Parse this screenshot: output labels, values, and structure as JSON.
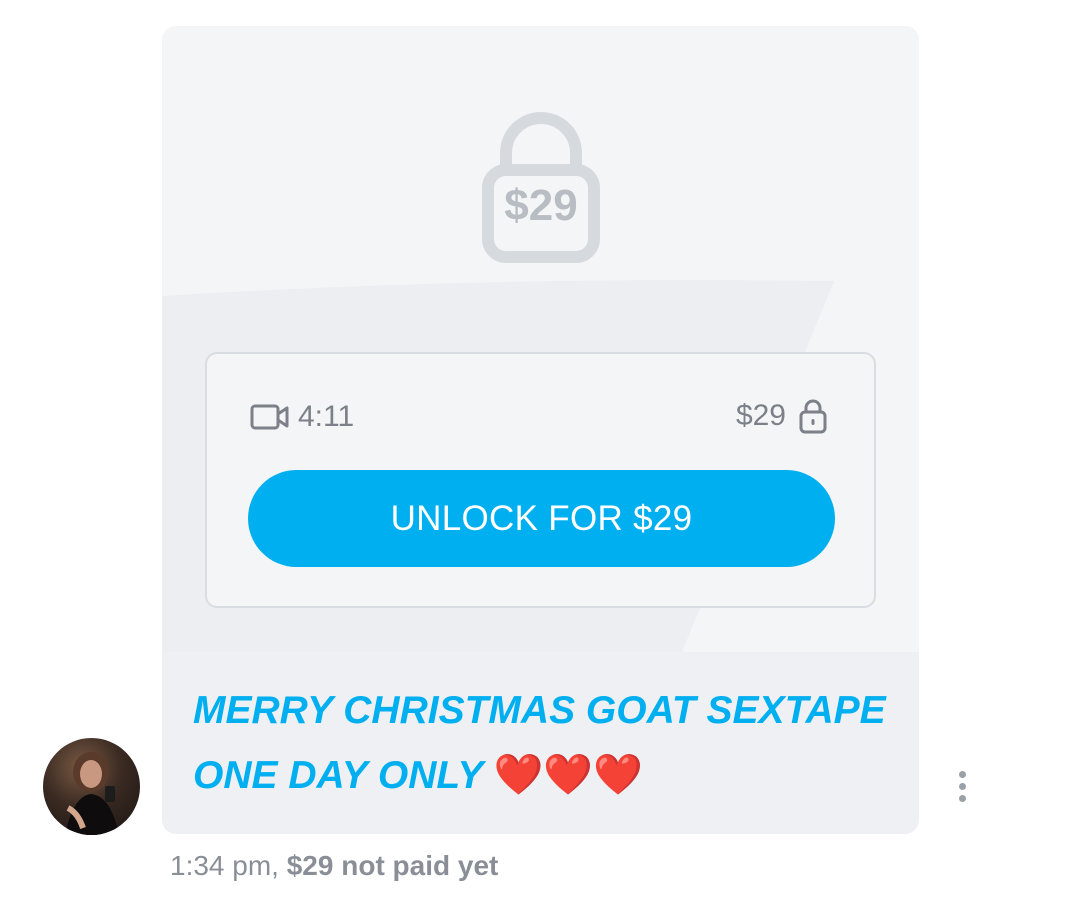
{
  "message": {
    "locked_media": {
      "lock_price": "$29",
      "media_type_icon": "video-camera-icon",
      "duration": "4:11",
      "price": "$29",
      "price_lock_icon": "lock-icon",
      "unlock_button_label": "UNLOCK FOR $29"
    },
    "caption": {
      "line1": "MERRY CHRISTMAS GOAT SEXTAPE",
      "line2": "ONE DAY ONLY",
      "emoji": "❤️❤️❤️"
    },
    "sender_avatar": "avatar",
    "more_options_icon": "more-vertical-icon",
    "footer": {
      "time": "1:34 pm,",
      "payment_status": "$29 not paid yet"
    }
  },
  "colors": {
    "accent": "#00aff0",
    "muted_text": "#7b8089",
    "bubble_bg": "#eef0f3",
    "media_bg": "#f4f5f7"
  }
}
